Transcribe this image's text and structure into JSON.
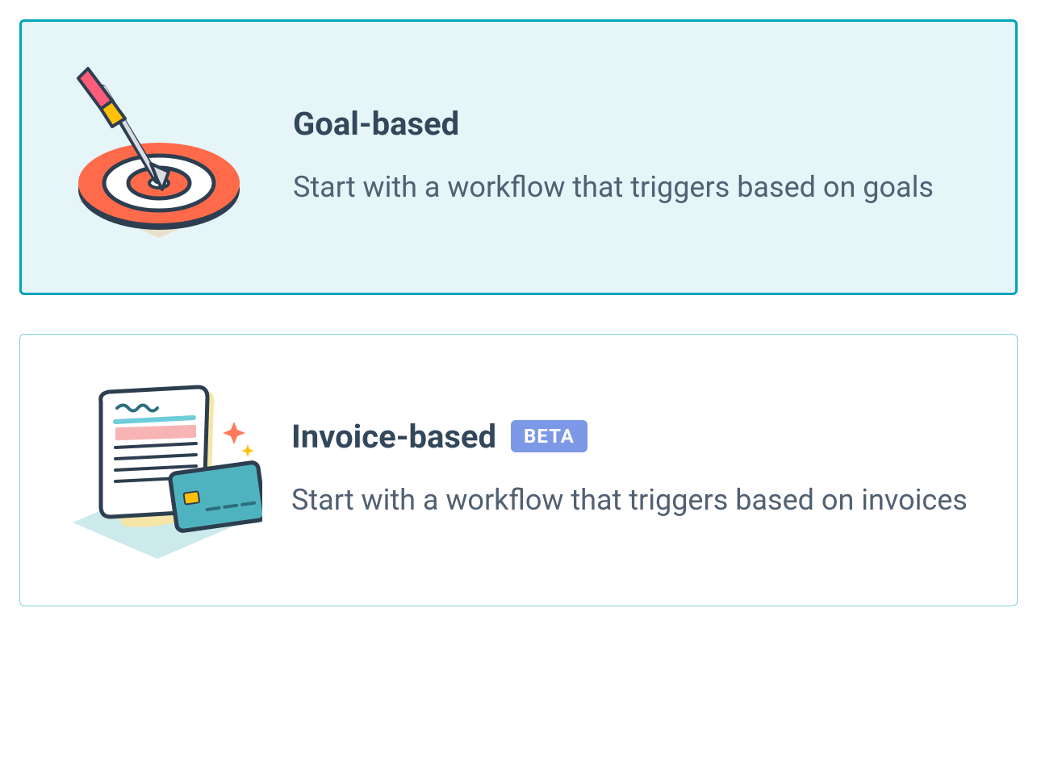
{
  "options": [
    {
      "id": "goal",
      "title": "Goal-based",
      "description": "Start with a workflow that triggers based on goals",
      "badge": null,
      "selected": true
    },
    {
      "id": "invoice",
      "title": "Invoice-based",
      "description": "Start with a workflow that triggers based on invoices",
      "badge": "BETA",
      "selected": false
    }
  ]
}
